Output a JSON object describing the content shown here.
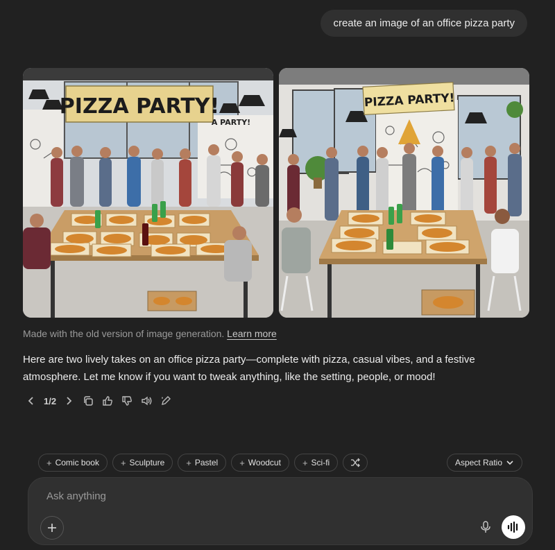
{
  "conversation": {
    "user_message": "create an image of an office pizza party",
    "images": [
      {
        "banner": "PIZZA PARTY!",
        "sign": "A PARTY!"
      },
      {
        "banner": "PIZZA PARTY!"
      }
    ],
    "image_note": "Made with the old version of image generation.",
    "learn_more": "Learn more",
    "response": "Here are two lively takes on an office pizza party—complete with pizza, casual vibes, and a festive atmosphere. Let me know if you want to tweak anything, like the setting, people, or mood!",
    "pager": "1/2",
    "icons": [
      "chevron-left",
      "chevron-right",
      "copy",
      "thumbs-up",
      "thumbs-down",
      "read-aloud",
      "edit-image"
    ]
  },
  "style_chips": [
    "Comic book",
    "Sculpture",
    "Pastel",
    "Woodcut",
    "Sci-fi"
  ],
  "aspect_ratio_label": "Aspect Ratio",
  "composer": {
    "placeholder": "Ask anything"
  },
  "colors": {
    "background": "#212121",
    "bubble": "#303030",
    "text": "#ececec",
    "muted": "#9b9b9b"
  }
}
